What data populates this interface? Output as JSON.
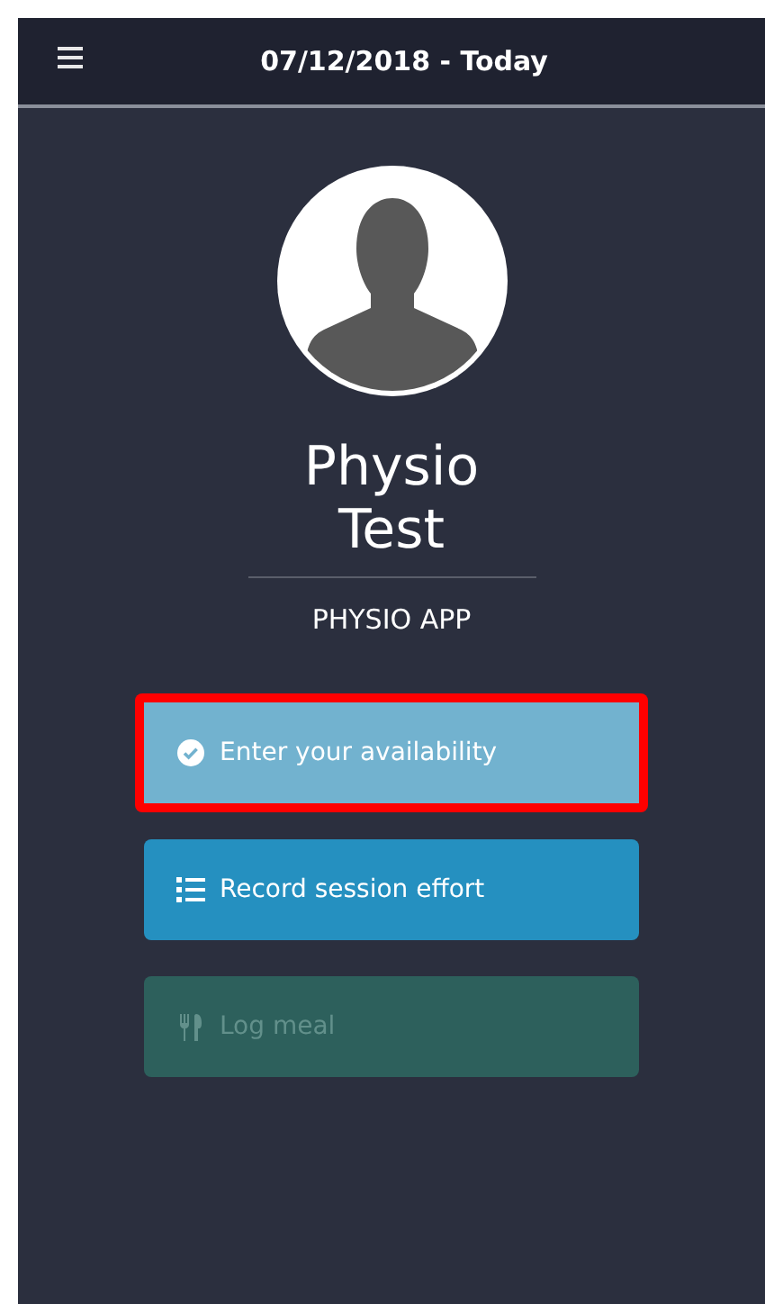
{
  "header": {
    "title": "07/12/2018 - Today"
  },
  "profile": {
    "name": "Physio Test",
    "subtitle": "PHYSIO APP"
  },
  "actions": [
    {
      "label": "Enter your availability",
      "kind": "check",
      "highlighted": true,
      "disabled": false
    },
    {
      "label": "Record session effort",
      "kind": "list",
      "highlighted": false,
      "disabled": false
    },
    {
      "label": "Log meal",
      "kind": "meal",
      "highlighted": false,
      "disabled": true
    }
  ]
}
